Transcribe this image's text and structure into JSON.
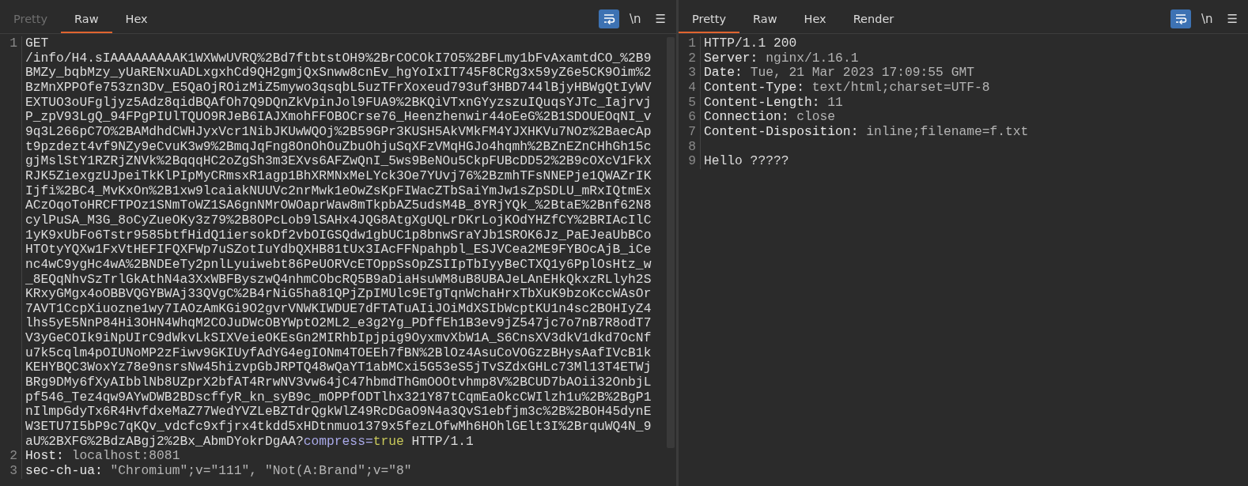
{
  "panes": [
    {
      "tabs": [
        {
          "label": "Pretty",
          "selected": false,
          "disabled": true
        },
        {
          "label": "Raw",
          "selected": true,
          "disabled": false
        },
        {
          "label": "Hex",
          "selected": false,
          "disabled": false
        }
      ],
      "toolbar": [
        {
          "kind": "wrap",
          "selected": true
        },
        {
          "kind": "text",
          "label": "\\n",
          "selected": false
        },
        {
          "kind": "text",
          "label": "☰",
          "selected": false
        }
      ],
      "lines": [
        {
          "number": "1",
          "rows": [
            [
              {
                "kind": "plain",
                "text": "GET"
              }
            ],
            [
              {
                "kind": "plain",
                "text": "/info/H4.sIAAAAAAAAAK1WXWwUVRQ%2Bd7ftbtstOH9%2BrCOCOkI7O5%2BFLmy1bFvAxamtdCO_%2B9"
              }
            ],
            [
              {
                "kind": "plain",
                "text": "BMZy_bqbMzy_yUaRENxuADLxgxhCd9QH2gmjQxSnww8cnEv_hgYoIxIT745F8CRg3x59yZ6e5CK9Oim%2"
              }
            ],
            [
              {
                "kind": "plain",
                "text": "BzMnXPPOfe753zn3Dv_E5QaOjROizMiZ5mywo3qsqbL5uzTFrXoxeud793uf3HBD744lBjyHBWgQtIyWV"
              }
            ],
            [
              {
                "kind": "plain",
                "text": "EXTUO3oUFgljyz5Adz8qidBQAfOh7Q9DQnZkVpinJol9FUA9%2BKQiVTxnGYyzszuIQuqsYJTc_Iajrvj"
              }
            ],
            [
              {
                "kind": "plain",
                "text": "P_zpV93LgQ_94FPgPIUlTQUO9RJeB6IAJXmohFFOBOCrse76_Heenzhenwir44oEeG%2B1SDOUEOqNI_v"
              }
            ],
            [
              {
                "kind": "plain",
                "text": "9q3L266pC7O%2BAMdhdCWHJyxVcr1NibJKUwWQOj%2B59GPr3KUSH5AkVMkFM4YJXHKVu7NOz%2BaecAp"
              }
            ],
            [
              {
                "kind": "plain",
                "text": "t9pzdezt4vf9NZy9eCvuK3w9%2BmqJqFng8OnOhOuZbuOhjuSqXFzVMqHGJo4hqmh%2BZnEZnCHhGh15c"
              }
            ],
            [
              {
                "kind": "plain",
                "text": "gjMslStY1RZRjZNVk%2BqqqHC2oZgSh3m3EXvs6AFZwQnI_5ws9BeNOu5CkpFUBcDD52%2B9cOXcV1FkX"
              }
            ],
            [
              {
                "kind": "plain",
                "text": "RJK5ZiexgzUJpeiTkKlPIpMyCRmsxR1agp1BhXRMNxMeLYck3Oe7YUvj76%2BzmhTFsNNEPje1QWAZrIK"
              }
            ],
            [
              {
                "kind": "plain",
                "text": "Ijfi%2BC4_MvKxOn%2B1xw9lcaiakNUUVc2nrMwk1eOwZsKpFIWacZTbSaiYmJw1sZpSDLU_mRxIQtmEx"
              }
            ],
            [
              {
                "kind": "plain",
                "text": "ACzOqoToHRCFTPOz1SNmToWZ1SA6gnNMrOWOaprWaw8mTkpbAZ5udsM4B_8YRjYQk_%2BtaE%2Bnf62N8"
              }
            ],
            [
              {
                "kind": "plain",
                "text": "cylPuSA_M3G_8oCyZueOKy3z79%2B8OPcLob9lSAHx4JQG8AtgXgUQLrDKrLojKOdYHZfCY%2BRIAcIlC"
              }
            ],
            [
              {
                "kind": "plain",
                "text": "1yK9xUbFo6Tstr9585btfHidQ1iersokDf2vbOIGSQdw1gbUC1p8bnwSraYJb1SROK6Jz_PaEJeaUbBCo"
              }
            ],
            [
              {
                "kind": "plain",
                "text": "HTOtyYQXw1FxVtHEFIFQXFWp7uSZotIuYdbQXHB81tUx3IAcFFNpahpbl_ESJVCea2ME9FYBOcAjB_iCe"
              }
            ],
            [
              {
                "kind": "plain",
                "text": "nc4wC9ygHc4wA%2BNDEeTy2pnlLyuiwebt86PeUORVcETOppSsOpZSIIpTbIyyBeCTXQ1y6PplOsHtz_w"
              }
            ],
            [
              {
                "kind": "plain",
                "text": "_8EQqNhvSzTrlGkAthN4a3XxWBFByszwQ4nhmCObcRQ5B9aDiaHsuWM8uB8UBAJeLAnEHkQkxzRLlyh2S"
              }
            ],
            [
              {
                "kind": "plain",
                "text": "KRxyGMgx4oOBBVQGYBWAj33QVgC%2B4rNiG5ha81QPjZpIMUlc9ETgTqnWchaHrxTbXuK9bzoKccWAsOr"
              }
            ],
            [
              {
                "kind": "plain",
                "text": "7AVT1CcpXiuozne1wy7IAOzAmKGi9O2gvrVNWKIWDUE7dFTATuAIiJOiMdXSIbWcptKU1n4sc2BOHIyZ4"
              }
            ],
            [
              {
                "kind": "plain",
                "text": "lhs5yE5NnP84Hi3OHN4WhqM2COJuDWcOBYWptO2ML2_e3g2Yg_PDffEh1B3ev9jZ547jc7o7nB7R8odT7"
              }
            ],
            [
              {
                "kind": "plain",
                "text": "V3yGeCOIk9iNpUIrC9dWkvLkSIXVeieOKEsGn2MIRhbIpjpig9OyxmvXbW1A_S6CnsXV3dkV1dkd7OcNf"
              }
            ],
            [
              {
                "kind": "plain",
                "text": "u7k5cqlm4pOIUNoMP2zFiwv9GKIUyfAdYG4egIONm4TOEEh7fBN%2BlOz4AsuCoVOGzzBHysAafIVcB1k"
              }
            ],
            [
              {
                "kind": "plain",
                "text": "KEHYBQC3WoxYz78e9nsrsNw45hizvpGbJRPTQ48wQaYT1abMCxi5G53eS5jTvSZdxGHLc73Ml13T4ETWj"
              }
            ],
            [
              {
                "kind": "plain",
                "text": "BRg9DMy6fXyAIbblNb8UZprX2bfAT4RrwNV3vw64jC47hbmdThGmOOOtvhmp8V%2BCUD7bAOii32OnbjL"
              }
            ],
            [
              {
                "kind": "plain",
                "text": "pf546_Tez4qw9AYwDWB2BDscffyR_kn_syB9c_mOPPfODTlhx321Y87tCqmEaOkcCWIlzh1u%2B%2BgP1"
              }
            ],
            [
              {
                "kind": "plain",
                "text": "nIlmpGdyTx6R4HvfdxeMaZ77WedYVZLeBZTdrQgkWlZ49RcDGaO9N4a3QvS1ebfjm3c%2B%2BOH45dynE"
              }
            ],
            [
              {
                "kind": "plain",
                "text": "W3ETU7I5bP9c7qKQv_vdcfc9xfjrx4tkdd5xHDtnmuo1379x5fezLOfwMh6HOhlGElt3I%2BrquWQ4N_9"
              }
            ],
            [
              {
                "kind": "plain",
                "text": "aU%2BXFG%2BdzABgj2%2Bx_AbmDYokrDgAA?"
              },
              {
                "kind": "param_name",
                "text": "compress="
              },
              {
                "kind": "param_value",
                "text": "true"
              },
              {
                "kind": "plain",
                "text": " HTTP/1.1"
              }
            ]
          ]
        },
        {
          "number": "2",
          "rows": [
            [
              {
                "kind": "header_name",
                "text": "Host:"
              },
              {
                "kind": "header_value",
                "text": " localhost:8081"
              }
            ]
          ]
        },
        {
          "number": "3",
          "rows": [
            [
              {
                "kind": "header_name",
                "text": "sec-ch-ua:"
              },
              {
                "kind": "header_value",
                "text": " \"Chromium\";v=\"111\", \"Not(A:Brand\";v=\"8\""
              }
            ]
          ]
        }
      ]
    },
    {
      "tabs": [
        {
          "label": "Pretty",
          "selected": true,
          "disabled": false
        },
        {
          "label": "Raw",
          "selected": false,
          "disabled": false
        },
        {
          "label": "Hex",
          "selected": false,
          "disabled": false
        },
        {
          "label": "Render",
          "selected": false,
          "disabled": false
        }
      ],
      "toolbar": [
        {
          "kind": "wrap",
          "selected": true
        },
        {
          "kind": "text",
          "label": "\\n",
          "selected": false
        },
        {
          "kind": "text",
          "label": "☰",
          "selected": false
        }
      ],
      "lines": [
        {
          "number": "1",
          "rows": [
            [
              {
                "kind": "plain",
                "text": "HTTP/1.1 200"
              }
            ]
          ]
        },
        {
          "number": "2",
          "rows": [
            [
              {
                "kind": "header_name",
                "text": "Server:"
              },
              {
                "kind": "header_value",
                "text": " nginx/1.16.1"
              }
            ]
          ]
        },
        {
          "number": "3",
          "rows": [
            [
              {
                "kind": "header_name",
                "text": "Date:"
              },
              {
                "kind": "header_value",
                "text": " Tue, 21 Mar 2023 17:09:55 GMT"
              }
            ]
          ]
        },
        {
          "number": "4",
          "rows": [
            [
              {
                "kind": "header_name",
                "text": "Content-Type:"
              },
              {
                "kind": "header_value",
                "text": " text/html;charset=UTF-8"
              }
            ]
          ]
        },
        {
          "number": "5",
          "rows": [
            [
              {
                "kind": "header_name",
                "text": "Content-Length:"
              },
              {
                "kind": "header_value",
                "text": " 11"
              }
            ]
          ]
        },
        {
          "number": "6",
          "rows": [
            [
              {
                "kind": "header_name",
                "text": "Connection:"
              },
              {
                "kind": "header_value",
                "text": " close"
              }
            ]
          ]
        },
        {
          "number": "7",
          "rows": [
            [
              {
                "kind": "header_name",
                "text": "Content-Disposition:"
              },
              {
                "kind": "header_value",
                "text": " inline;filename=f.txt"
              }
            ]
          ]
        },
        {
          "number": "8"
        },
        {
          "number": "9",
          "rows": [
            [
              {
                "kind": "plain",
                "text": "Hello ?????"
              }
            ]
          ]
        }
      ]
    }
  ]
}
